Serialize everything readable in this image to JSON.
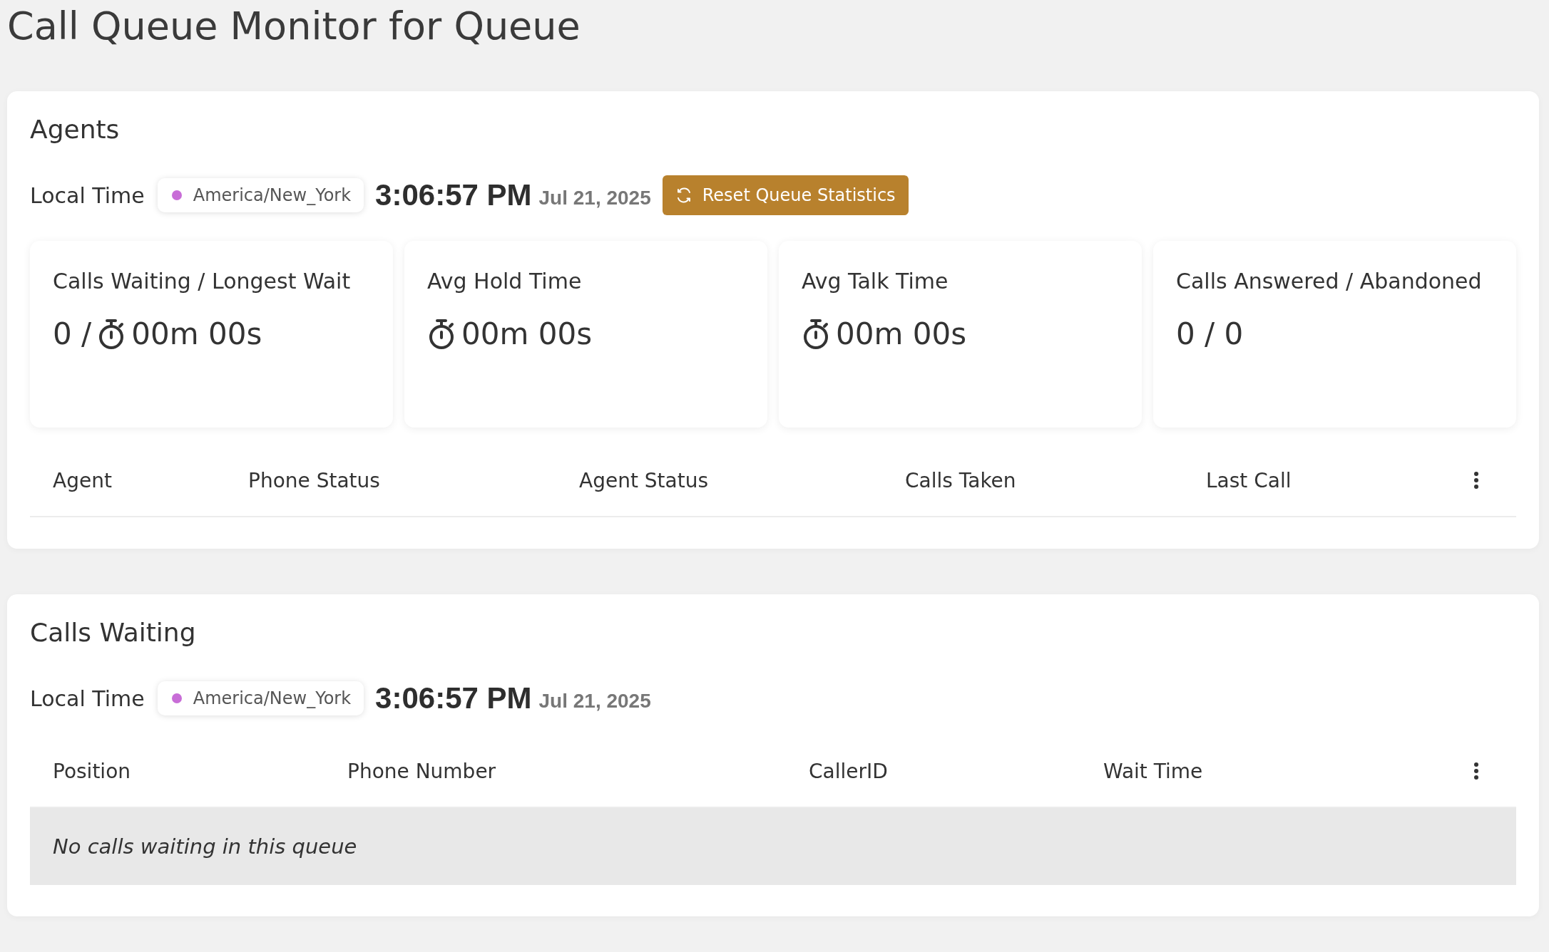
{
  "page_title": "Call Queue Monitor for Queue",
  "agents_panel": {
    "title": "Agents",
    "local_time": {
      "label": "Local Time",
      "timezone": "America/New_York",
      "time": "3:06:57 PM",
      "date": "Jul 21, 2025"
    },
    "reset_button": "Reset Queue Statistics",
    "stat_cards": [
      {
        "title": "Calls Waiting / Longest Wait",
        "value": [
          {
            "kind": "text",
            "text": "0 /"
          },
          {
            "kind": "timer",
            "text": "00m 00s"
          }
        ]
      },
      {
        "title": "Avg Hold Time",
        "value": [
          {
            "kind": "timer",
            "text": "00m 00s"
          }
        ]
      },
      {
        "title": "Avg Talk Time",
        "value": [
          {
            "kind": "timer",
            "text": "00m 00s"
          }
        ]
      },
      {
        "title": "Calls Answered / Abandoned",
        "value": [
          {
            "kind": "text",
            "text": "0 / 0"
          }
        ]
      }
    ],
    "table": {
      "columns": [
        "Agent",
        "Phone Status",
        "Agent Status",
        "Calls Taken",
        "Last Call"
      ]
    }
  },
  "calls_panel": {
    "title": "Calls Waiting",
    "local_time": {
      "label": "Local Time",
      "timezone": "America/New_York",
      "time": "3:06:57 PM",
      "date": "Jul 21, 2025"
    },
    "table": {
      "columns": [
        "Position",
        "Phone Number",
        "CallerID",
        "Wait Time"
      ],
      "empty_message": "No calls waiting in this queue"
    }
  }
}
